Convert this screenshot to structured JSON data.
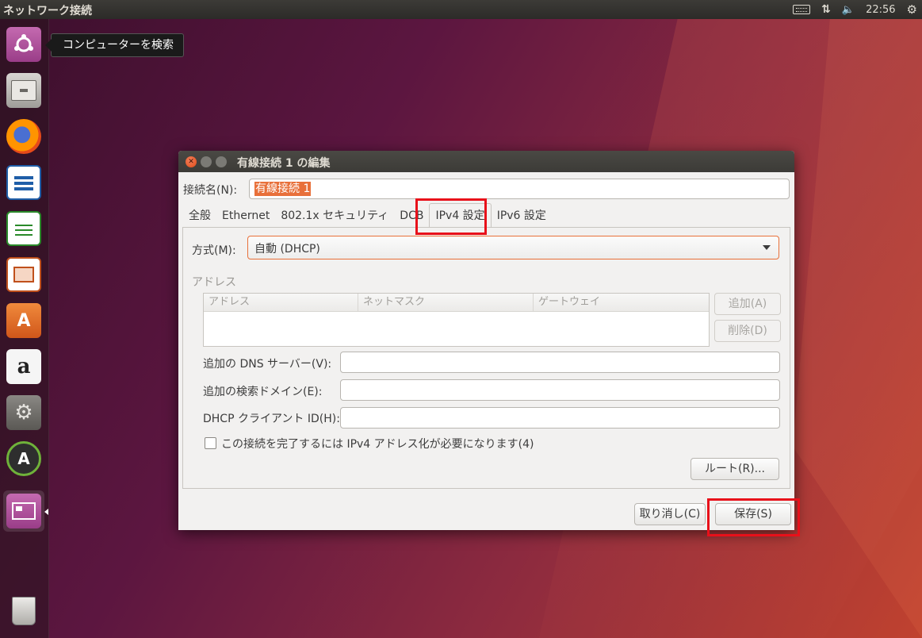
{
  "top_panel": {
    "app_title": "ネットワーク接続",
    "clock": "22:56",
    "icons": [
      "keyboard-icon",
      "network-updown-icon",
      "volume-icon",
      "settings-gear-icon"
    ]
  },
  "launcher": {
    "tooltip": "コンピューターを検索",
    "items": [
      "ubuntu-dash-icon",
      "files-icon",
      "firefox-icon",
      "writer-icon",
      "calc-icon",
      "impress-icon",
      "software-center-icon",
      "amazon-icon",
      "system-settings-icon",
      "software-updater-icon",
      "network-connections-icon",
      "trash-icon"
    ]
  },
  "dialog": {
    "title": "有線接続 1 の編集",
    "name_label": "接続名(N):",
    "name_value": "有線接続 1",
    "tabs": [
      {
        "label": "全般"
      },
      {
        "label": "Ethernet"
      },
      {
        "label": "802.1x セキュリティ"
      },
      {
        "label": "DCB"
      },
      {
        "label": "IPv4 設定"
      },
      {
        "label": "IPv6 設定"
      }
    ],
    "method_label": "方式(M):",
    "method_value": "自動 (DHCP)",
    "address_section": "アドレス",
    "address_columns": [
      "アドレス",
      "ネットマスク",
      "ゲートウェイ"
    ],
    "add_button": "追加(A)",
    "delete_button": "削除(D)",
    "dns_label": "追加の DNS サーバー(V):",
    "search_domain_label": "追加の検索ドメイン(E):",
    "dhcp_client_id_label": "DHCP クライアント ID(H):",
    "require_ipv4_label": "この接続を完了するには IPv4 アドレス化が必要になります(4)",
    "require_ipv4_checked": false,
    "routes_button": "ルート(R)...",
    "cancel_button": "取り消し(C)",
    "save_button": "保存(S)"
  },
  "colors": {
    "accent": "#e8703a",
    "highlight": "#e8101a",
    "panel": "#3c3b37"
  }
}
